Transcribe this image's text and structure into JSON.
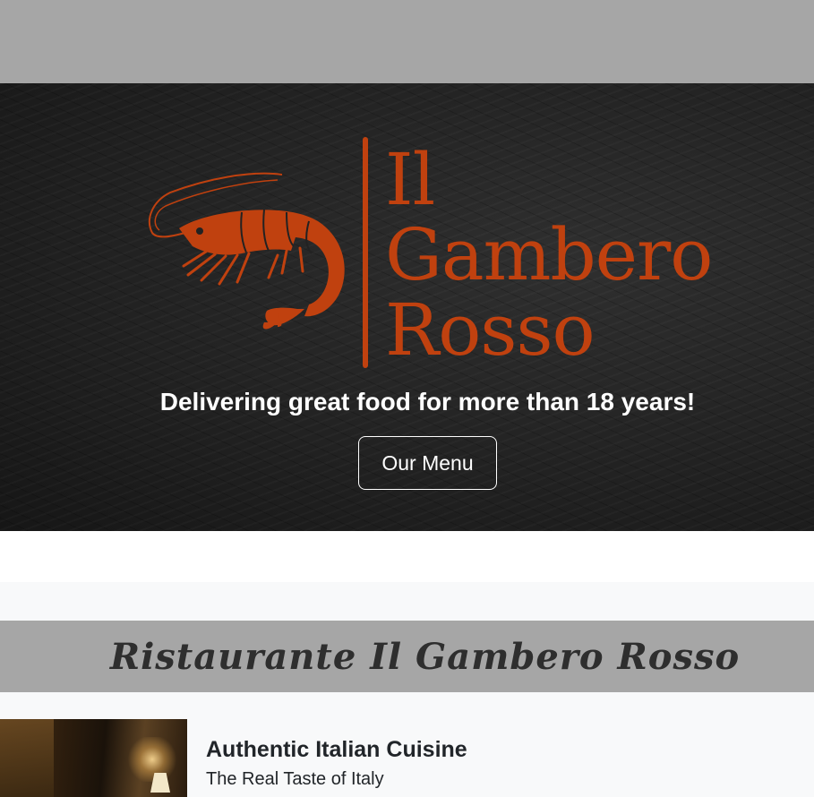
{
  "hero": {
    "logo": {
      "line1": "Il",
      "line2": "Gambero",
      "line3": "Rosso",
      "icon": "shrimp-icon"
    },
    "tagline": "Delivering great food for more than 18 years!",
    "menu_button_label": "Our Menu"
  },
  "section": {
    "title": "Ristaurante Il Gambero Rosso"
  },
  "feature": {
    "title": "Authentic Italian Cuisine",
    "subtitle": "The Real Taste of Italy",
    "photo": "street-lamp-photo"
  },
  "colors": {
    "brand": "#c0410f",
    "header_gray": "#a6a6a6",
    "hero_dark": "#222222",
    "light_bg": "#f8f9fa",
    "text_dark": "#212529"
  }
}
